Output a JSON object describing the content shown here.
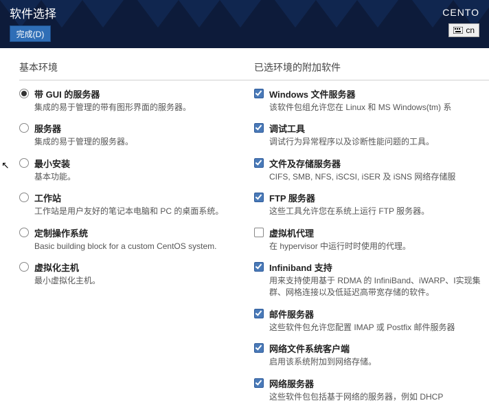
{
  "header": {
    "title": "软件选择",
    "done": "完成(D)",
    "os": "CENTO",
    "lang": "cn"
  },
  "env": {
    "heading": "基本环境",
    "items": [
      {
        "label": "带 GUI 的服务器",
        "desc": "集成的易于管理的带有图形界面的服务器。",
        "sel": true
      },
      {
        "label": "服务器",
        "desc": "集成的易于管理的服务器。",
        "sel": false
      },
      {
        "label": "最小安装",
        "desc": "基本功能。",
        "sel": false
      },
      {
        "label": "工作站",
        "desc": "工作站是用户友好的笔记本电脑和 PC 的桌面系统。",
        "sel": false
      },
      {
        "label": "定制操作系统",
        "desc": "Basic building block for a custom CentOS system.",
        "sel": false
      },
      {
        "label": "虚拟化主机",
        "desc": "最小虚拟化主机。",
        "sel": false
      }
    ]
  },
  "addons": {
    "heading": "已选环境的附加软件",
    "items": [
      {
        "label": "Windows 文件服务器",
        "desc": "该软件包组允许您在 Linux 和 MS Windows(tm) 系",
        "sel": true
      },
      {
        "label": "调试工具",
        "desc": "调试行为异常程序以及诊断性能问题的工具。",
        "sel": true
      },
      {
        "label": "文件及存储服务器",
        "desc": "CIFS, SMB, NFS, iSCSI, iSER 及 iSNS 网络存储服",
        "sel": true
      },
      {
        "label": "FTP 服务器",
        "desc": "这些工具允许您在系统上运行 FTP 服务器。",
        "sel": true
      },
      {
        "label": "虚拟机代理",
        "desc": "在 hypervisor 中运行时时使用的代理。",
        "sel": false
      },
      {
        "label": "Infiniband 支持",
        "desc": "用来支持使用基于 RDMA 的 InfiniBand、iWARP、I实现集群、网格连接以及低延迟高带宽存储的软件。",
        "sel": true
      },
      {
        "label": "邮件服务器",
        "desc": "这些软件包允许您配置 IMAP 或 Postfix 邮件服务器",
        "sel": true
      },
      {
        "label": "网络文件系统客户端",
        "desc": "启用该系统附加到网络存储。",
        "sel": true
      },
      {
        "label": "网络服务器",
        "desc": "这些软件包包括基于网络的服务器，例如 DHCP",
        "sel": true
      }
    ]
  }
}
